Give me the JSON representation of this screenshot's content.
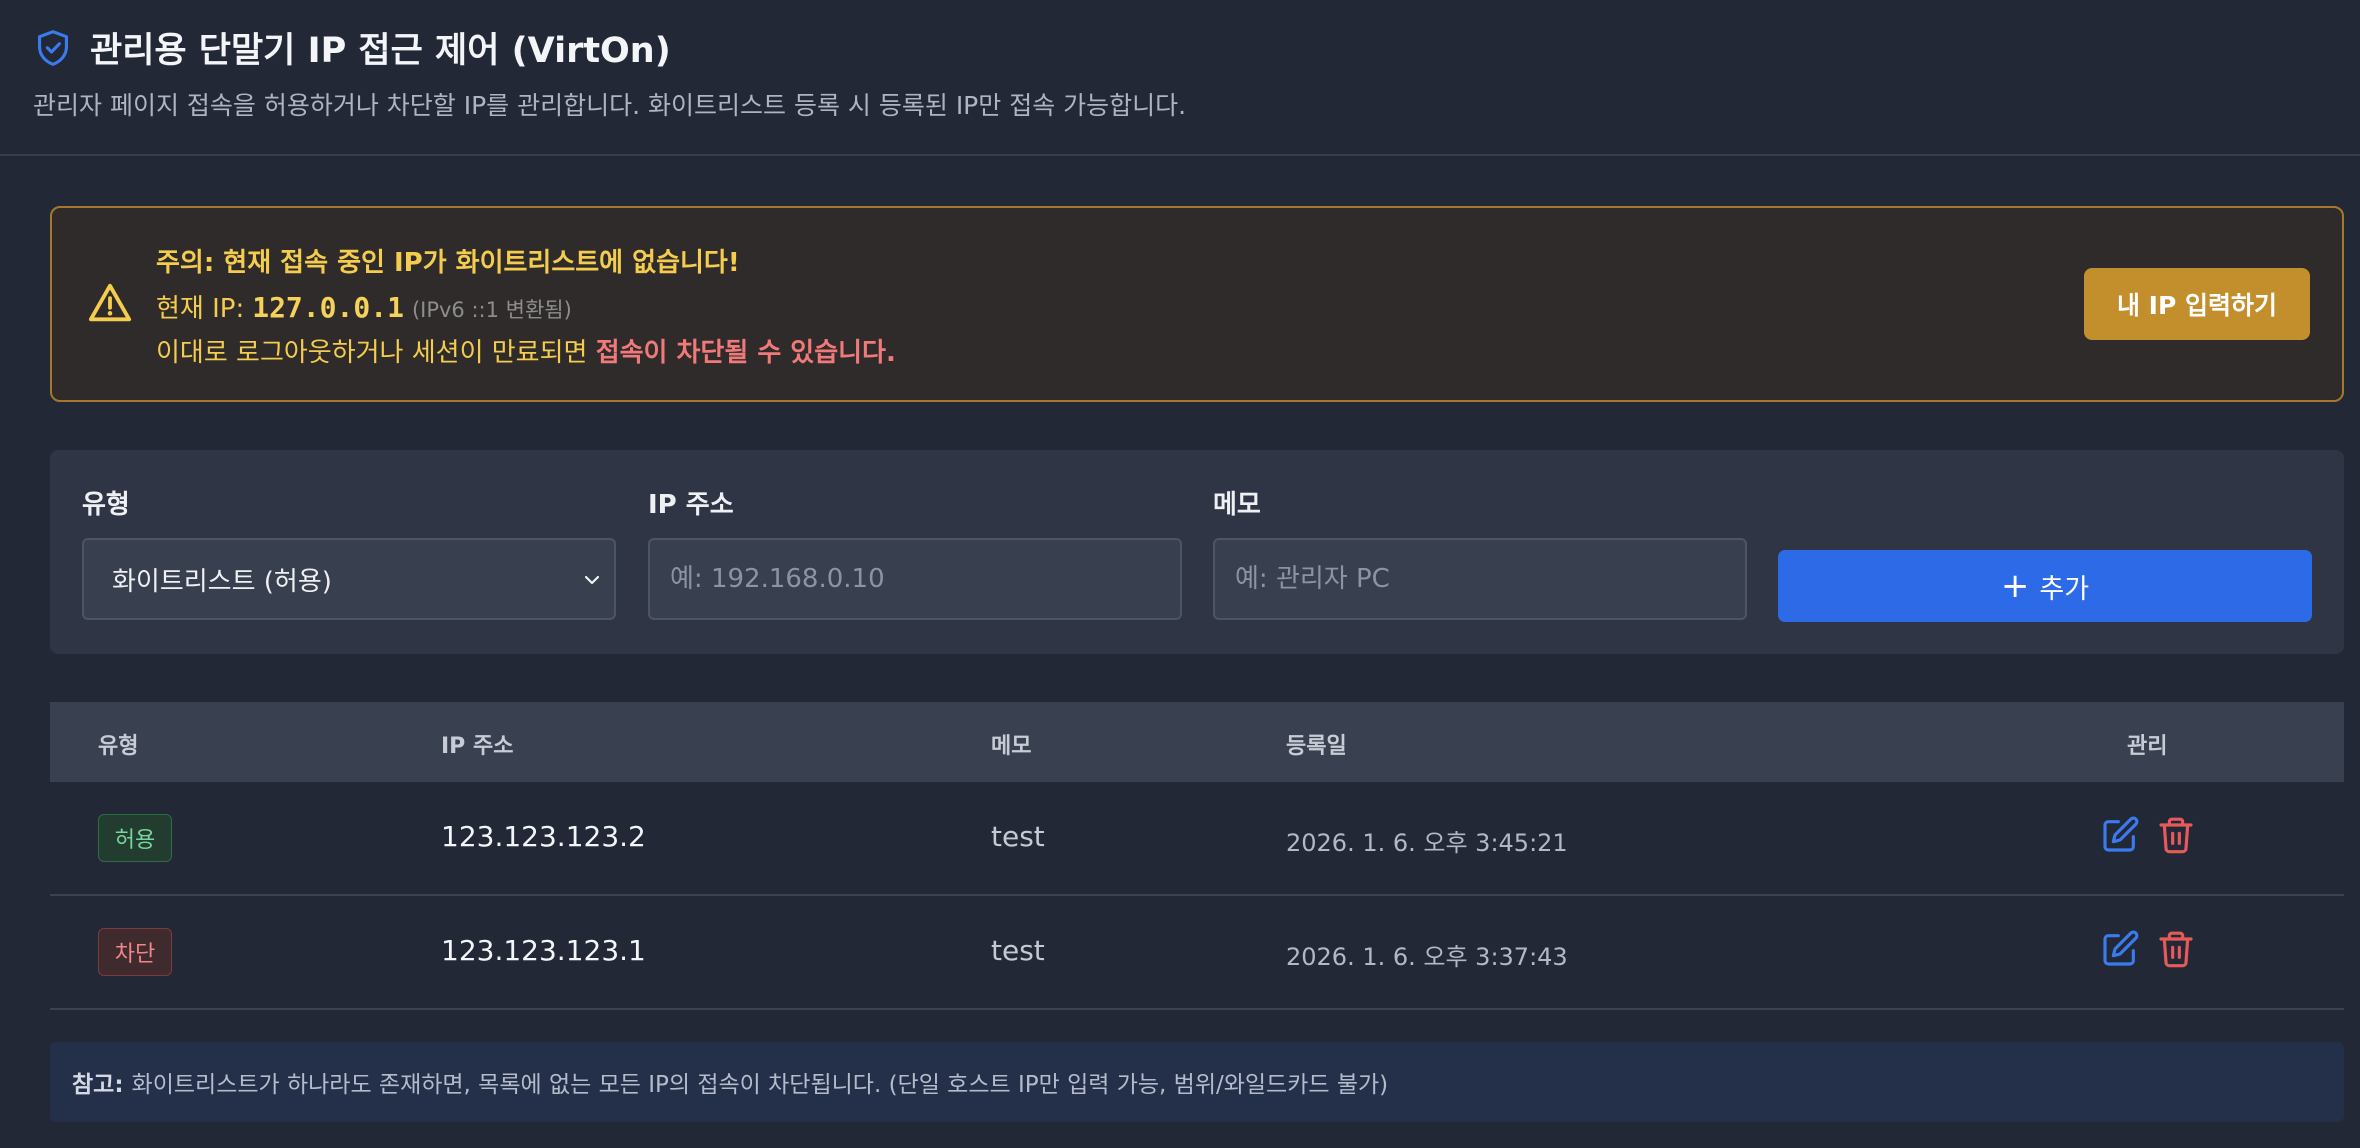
{
  "header": {
    "title": "관리용 단말기 IP 접근 제어 (VirtOn)",
    "subtitle": "관리자 페이지 접속을 허용하거나 차단할 IP를 관리합니다. 화이트리스트 등록 시 등록된 IP만 접속 가능합니다.",
    "icon": "shield-check-icon"
  },
  "alert": {
    "icon": "warning-triangle-icon",
    "title": "주의: 현재 접속 중인 IP가 화이트리스트에 없습니다!",
    "current_ip_label": "현재 IP:",
    "current_ip": "127.0.0.1",
    "ipv6_note": "(IPv6 ::1 변환됨)",
    "message_prefix": "이대로 로그아웃하거나 세션이 만료되면",
    "message_strong": "접속이 차단될 수 있습니다.",
    "button_label": "내 IP 입력하기"
  },
  "form": {
    "type_label": "유형",
    "type_value": "화이트리스트 (허용)",
    "ip_label": "IP 주소",
    "ip_placeholder": "예: 192.168.0.10",
    "memo_label": "메모",
    "memo_placeholder": "예: 관리자 PC",
    "add_button": "추가",
    "add_icon": "+"
  },
  "table": {
    "headers": [
      "유형",
      "IP 주소",
      "메모",
      "등록일",
      "관리"
    ],
    "rows": [
      {
        "type": "허용",
        "ip": "123.123.123.2",
        "memo": "test",
        "date": "2026. 1. 6. 오후 3:45:21"
      },
      {
        "type": "차단",
        "ip": "123.123.123.1",
        "memo": "test",
        "date": "2026. 1. 6. 오후 3:37:43"
      }
    ]
  },
  "note": {
    "label": "참고:",
    "text": "화이트리스트가 하나라도 존재하면, 목록에 없는 모든 IP의 접속이 차단됩니다. (단일 호스트 IP만 입력 가능, 범위/와일드카드 불가)"
  },
  "colors": {
    "background": "#222836",
    "accent_blue": "#2d6ae7",
    "warning": "#f4cc4e",
    "danger": "#f0797a",
    "allow_green": "#79d49b"
  }
}
